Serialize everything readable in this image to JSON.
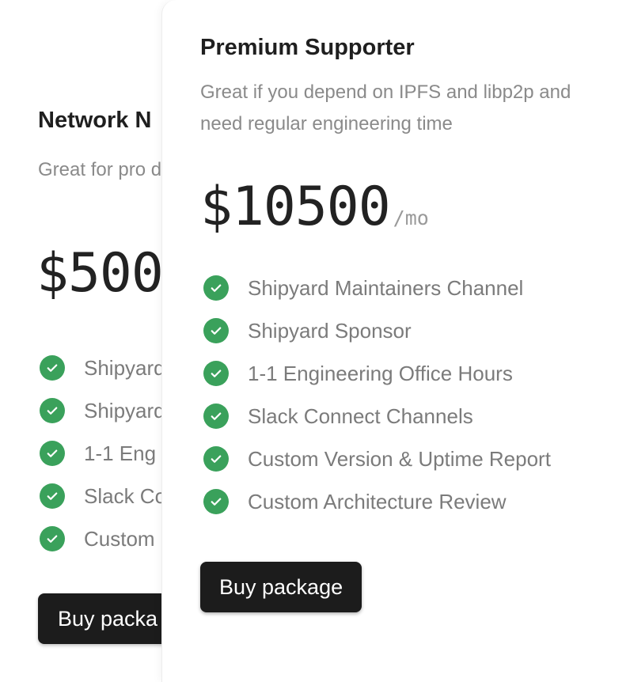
{
  "colors": {
    "accent_check": "#3aa15b",
    "button_bg": "#1c1c1c",
    "title": "#1f1f1f",
    "muted_text": "#8a8a8a"
  },
  "icons": {
    "feature_check": "check-circle-icon"
  },
  "plans": [
    {
      "title": "Network N",
      "description": "Great for pro dependency",
      "price": "$500",
      "features": [
        {
          "label": "Shipyard"
        },
        {
          "label": "Shipyard"
        },
        {
          "label": "1-1 Eng"
        },
        {
          "label": "Slack Co"
        },
        {
          "label": "Custom"
        }
      ],
      "button_label": "Buy packa"
    },
    {
      "title": "Premium Supporter",
      "description": "Great if you depend on IPFS and libp2p and need regular engineering time",
      "price": "$10500",
      "period": "/mo",
      "features": [
        {
          "label": "Shipyard Maintainers Channel"
        },
        {
          "label": "Shipyard Sponsor"
        },
        {
          "label": "1-1 Engineering Office Hours"
        },
        {
          "label": "Slack Connect Channels"
        },
        {
          "label": "Custom Version & Uptime Report"
        },
        {
          "label": "Custom Architecture Review"
        }
      ],
      "button_label": "Buy package"
    }
  ]
}
